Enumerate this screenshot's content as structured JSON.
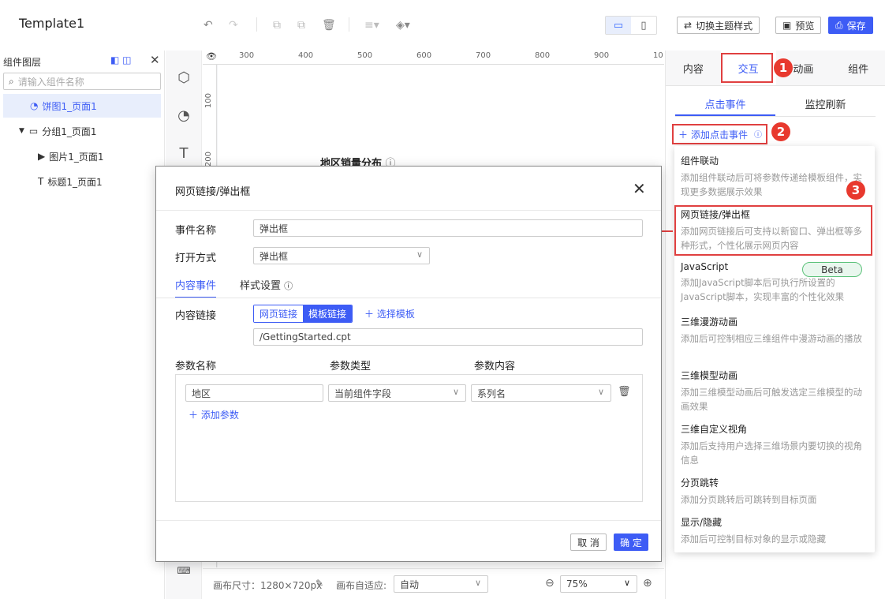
{
  "app": {
    "title": "Template1"
  },
  "toolbar": {
    "undo_icon": "undo-icon",
    "redo_icon": "redo-icon",
    "switch_theme_label": "切换主题样式",
    "preview_label": "预览",
    "save_label": "保存"
  },
  "left_panel": {
    "header": "组件图层",
    "search_placeholder": "请输入组件名称",
    "tree": [
      {
        "label": "饼图1_页面1",
        "selected": true,
        "icon": "pie-icon"
      },
      {
        "label": "分组1_页面1",
        "selected": false,
        "icon": "folder-icon"
      },
      {
        "label": "图片1_页面1",
        "selected": false,
        "icon": "image-icon"
      },
      {
        "label": "标题1_页面1",
        "selected": false,
        "icon": "text-icon"
      }
    ]
  },
  "ruler": {
    "h_ticks": [
      "300",
      "400",
      "500",
      "600",
      "700",
      "800",
      "900",
      "10"
    ],
    "v_ticks": [
      "100",
      "200"
    ]
  },
  "canvas": {
    "chart_title": "地区销量分布"
  },
  "bottom_bar": {
    "canvas_size": "画布尺寸：1280×720px",
    "adapt_label": "画布自适应:",
    "adapt_value": "自动",
    "zoom_value": "75%"
  },
  "right_panel": {
    "tabs": [
      "内容",
      "交互",
      "动画",
      "组件"
    ],
    "active_tab": "交互",
    "subtabs": [
      "点击事件",
      "监控刷新"
    ],
    "add_event_label": "添加点击事件",
    "menu": [
      {
        "title": "组件联动",
        "desc": "添加组件联动后可将参数传递给模板组件，实现更多数据展示效果"
      },
      {
        "title": "网页链接/弹出框",
        "desc": "添加网页链接后可支持以新窗口、弹出框等多种形式，个性化展示网页内容"
      },
      {
        "title": "JavaScript",
        "desc": "添加JavaScript脚本后可执行所设置的JavaScript脚本，实现丰富的个性化效果",
        "badge": "Beta"
      },
      {
        "title": "三维漫游动画",
        "desc": "添加后可控制相应三维组件中漫游动画的播放"
      },
      {
        "title": "三维模型动画",
        "desc": "添加三维模型动画后可触发选定三维模型的动画效果"
      },
      {
        "title": "三维自定义视角",
        "desc": "添加后支持用户选择三维场景内要切换的视角信息"
      },
      {
        "title": "分页跳转",
        "desc": "添加分页跳转后可跳转到目标页面"
      },
      {
        "title": "显示/隐藏",
        "desc": "添加后可控制目标对象的显示或隐藏"
      }
    ]
  },
  "annotations": {
    "n1": "1",
    "n2": "2",
    "n3": "3",
    "accent": "#e8392e"
  },
  "modal": {
    "title": "网页链接/弹出框",
    "event_name_label": "事件名称",
    "event_name_value": "弹出框",
    "open_mode_label": "打开方式",
    "open_mode_value": "弹出框",
    "tabs": [
      "内容事件",
      "样式设置"
    ],
    "content_link_label": "内容链接",
    "seg_options": [
      "网页链接",
      "模板链接"
    ],
    "seg_active": "模板链接",
    "select_template": "选择模板",
    "link_value": "/GettingStarted.cpt",
    "param_headers": [
      "参数名称",
      "参数类型",
      "参数内容"
    ],
    "params": [
      {
        "name": "地区",
        "type": "当前组件字段",
        "content": "系列名"
      }
    ],
    "add_param": "添加参数",
    "cancel": "取 消",
    "ok": "确 定"
  },
  "colors": {
    "brand": "#3d5cf5",
    "annotation_red": "#e8392e"
  }
}
